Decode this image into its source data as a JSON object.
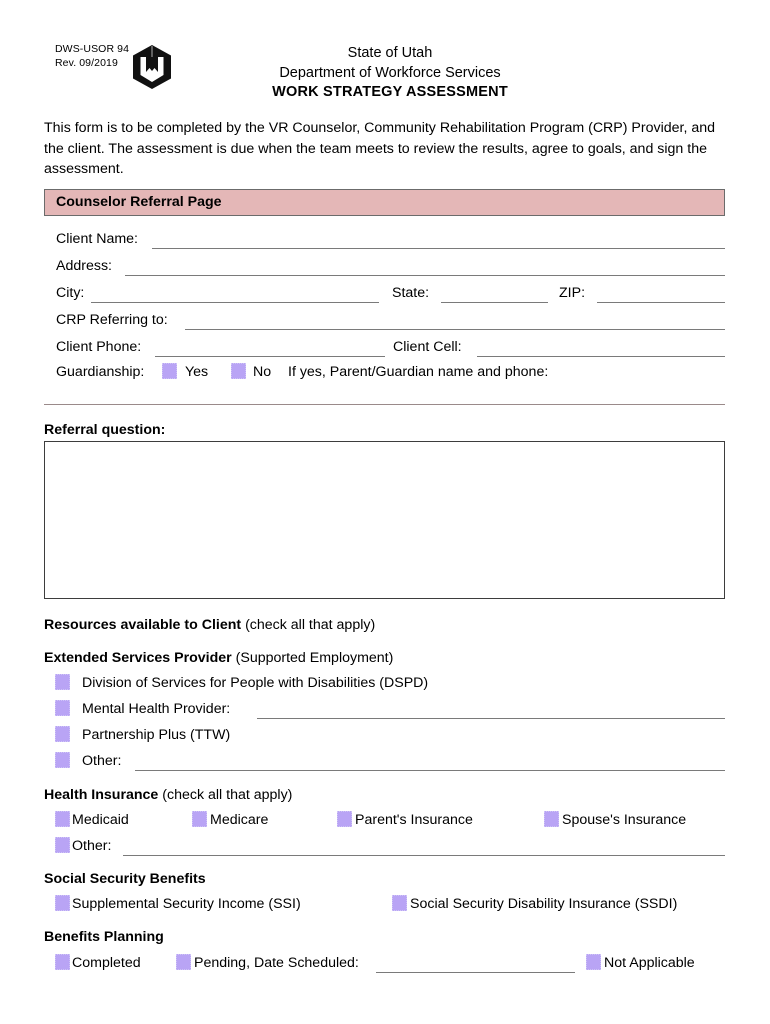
{
  "header": {
    "form_code_line1": "DWS-USOR 94",
    "form_code_line2": "Rev. 09/2019",
    "logo_name": "utah-dws-beehive-logo",
    "title_line1": "State of Utah",
    "title_line2": "Department of Workforce Services",
    "title_line3": "WORK STRATEGY ASSESSMENT"
  },
  "intro": "This form is to be completed by the VR Counselor, Community Rehabilitation Program (CRP) Provider, and the client. The assessment is due when the team meets to review the results, agree to goals, and sign the assessment.",
  "section_bar": {
    "label": "Counselor Referral Page",
    "background": "#e4b7b7"
  },
  "fields": {
    "client_name": "Client Name:",
    "address": "Address:",
    "city": "City:",
    "state": "State:",
    "zip": "ZIP:",
    "crp_referring_to": "CRP Referring to:",
    "client_phone": "Client Phone:",
    "client_cell": "Client Cell:",
    "guardianship": "Guardianship:",
    "guardianship_yes": "Yes",
    "guardianship_no": "No",
    "guardianship_note": "If yes, Parent/Guardian name and phone:"
  },
  "referral": {
    "label": "Referral question:",
    "value": ""
  },
  "resources": {
    "heading_bold": "Resources available to Client",
    "heading_normal": " (check all that apply)"
  },
  "extended_services": {
    "heading_bold": "Extended Services Provider",
    "heading_normal": " (Supported Employment)",
    "items": [
      {
        "label": "Division of Services for People with Disabilities (DSPD)",
        "has_line": false
      },
      {
        "label": "Mental Health Provider:",
        "has_line": true
      },
      {
        "label": "Partnership Plus (TTW)",
        "has_line": false
      },
      {
        "label": "Other:",
        "has_line": true
      }
    ]
  },
  "health_insurance": {
    "heading_bold": "Health Insurance",
    "heading_normal": " (check all that apply)",
    "row1": [
      "Medicaid",
      "Medicare",
      "Parent's Insurance",
      "Spouse's Insurance"
    ],
    "other_label": "Other:"
  },
  "social_security": {
    "heading_bold": "Social Security Benefits",
    "options": [
      "Supplemental Security Income (SSI)",
      "Social Security Disability Insurance (SSDI)"
    ]
  },
  "benefits_planning": {
    "heading_bold": "Benefits Planning",
    "completed": "Completed",
    "pending": "Pending, Date Scheduled:",
    "not_applicable": "Not Applicable"
  },
  "colors": {
    "checkbox": "#b9a4f5",
    "section_bar": "#e4b7b7",
    "rule": "#7a7a7a"
  }
}
